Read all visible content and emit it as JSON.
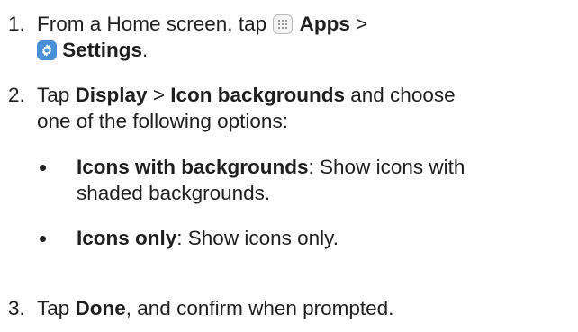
{
  "steps": [
    {
      "number": "1.",
      "line1_pre": "From a Home screen, tap ",
      "apps_icon": "apps-grid-icon",
      "apps_label": "Apps",
      "line1_post": " >",
      "settings_icon": "gear-icon",
      "settings_label": "Settings",
      "line2_post": "."
    },
    {
      "number": "2.",
      "pre": "Tap ",
      "display_label": "Display",
      "sep": " > ",
      "icon_bg_label": "Icon backgrounds",
      "post": " and choose",
      "line2": "one of the following options:"
    },
    {
      "number": "3.",
      "pre": "Tap ",
      "done_label": "Done",
      "post": ", and confirm when prompted."
    }
  ],
  "options": [
    {
      "label": "Icons with backgrounds",
      "desc_line1": ": Show icons with",
      "desc_line2": "shaded backgrounds."
    },
    {
      "label": "Icons only",
      "desc_line1": ": Show icons only."
    }
  ],
  "colors": {
    "text": "#1f1f1f",
    "settings_icon_bg": "#4a90d9"
  }
}
